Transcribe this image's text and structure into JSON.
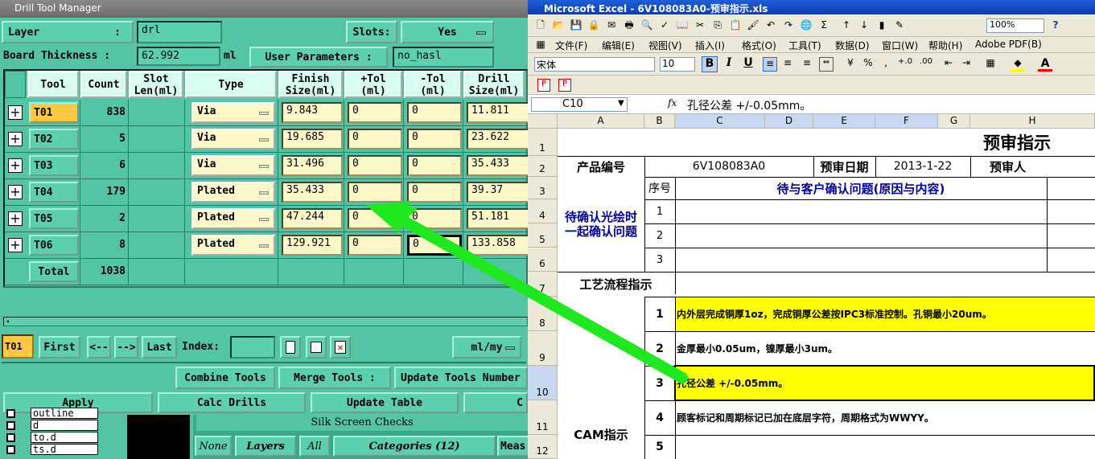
{
  "drill_window": {
    "title": "Drill Tool Manager",
    "layer_label": "Layer",
    "layer_colon": ":",
    "layer_value": "drl",
    "slots_label": "Slots:",
    "slots_value": "Yes",
    "board_thickness_label": "Board Thickness :",
    "board_thickness_value": "62.992",
    "board_thickness_unit": "ml",
    "user_params_label": "User Parameters :",
    "user_params_value": "no_hasl",
    "columns": [
      "Tool",
      "Count",
      "Slot\nLen(ml)",
      "Type",
      "Finish\nSize(ml)",
      "+Tol\n(ml)",
      "-Tol\n(ml)",
      "Drill\nSize(ml)"
    ],
    "rows": [
      {
        "tool": "T01",
        "count": "838",
        "type": "Via",
        "finish": "9.843",
        "ptol": "0",
        "ntol": "0",
        "drill": "11.811"
      },
      {
        "tool": "T02",
        "count": "5",
        "type": "Via",
        "finish": "19.685",
        "ptol": "0",
        "ntol": "0",
        "drill": "23.622"
      },
      {
        "tool": "T03",
        "count": "6",
        "type": "Via",
        "finish": "31.496",
        "ptol": "0",
        "ntol": "0",
        "drill": "35.433"
      },
      {
        "tool": "T04",
        "count": "179",
        "type": "Plated",
        "finish": "35.433",
        "ptol": "0",
        "ntol": "0",
        "drill": "39.37"
      },
      {
        "tool": "T05",
        "count": "2",
        "type": "Plated",
        "finish": "47.244",
        "ptol": "0",
        "ntol": "0",
        "drill": "51.181"
      },
      {
        "tool": "T06",
        "count": "8",
        "type": "Plated",
        "finish": "129.921",
        "ptol": "0",
        "ntol": "0",
        "drill": "133.858"
      }
    ],
    "total_label": "Total",
    "total_count": "1038",
    "nav": {
      "current": "T01",
      "first": "First",
      "prev": "<--",
      "next": "-->",
      "last": "Last",
      "index_label": "Index:",
      "units": "ml/my"
    },
    "combine": "Combine Tools",
    "merge": "Merge Tools :",
    "update_tools": "Update Tools Number",
    "apply": "Apply",
    "calc": "Calc Drills",
    "update_table": "Update Table",
    "partial": "C",
    "bottom_list": [
      "outline",
      "d",
      "to.d",
      "ts.d"
    ],
    "silk": "Silk Screen Checks",
    "none": "None",
    "layers": "Layers",
    "all": "All",
    "categories": "Categories (12)",
    "meas": "Meas"
  },
  "excel": {
    "title": "Microsoft Excel - 6V108083A0-预审指示.xls",
    "menu": [
      "文件(F)",
      "编辑(E)",
      "视图(V)",
      "插入(I)",
      "格式(O)",
      "工具(T)",
      "数据(D)",
      "窗口(W)",
      "帮助(H)",
      "Adobe PDF(B)"
    ],
    "zoom": "100%",
    "font": "宋体",
    "font_size": "10",
    "name_box": "C10",
    "fx": "fx",
    "formula": "孔径公差 +/-0.05mm。",
    "cols": [
      "A",
      "B",
      "C",
      "D",
      "E",
      "F",
      "G",
      "H"
    ],
    "rows": [
      "1",
      "2",
      "3",
      "4",
      "5",
      "6",
      "7",
      "8",
      "9",
      "10",
      "11",
      "12"
    ],
    "heading": "预审指示",
    "product_label": "产品编号",
    "product_value": "6V108083A0",
    "date_label": "预审日期",
    "date_value": "2013-1-22",
    "reviewer_label": "预审人",
    "seq_label": "序号",
    "issue_header": "待与客户确认问题(原因与内容)",
    "confirm_label": "待确认光绘时一起确认问题",
    "seq": [
      "1",
      "2",
      "3"
    ],
    "process_label": "工艺流程指示",
    "cam_label": "CAM指示",
    "cam_items": [
      {
        "n": "1",
        "text": "内外层完成铜厚1oz，完成铜厚公差按IPC3标准控制。孔铜最小20um。",
        "hl": true
      },
      {
        "n": "2",
        "text": "金厚最小0.05um，镍厚最小3um。",
        "hl": false
      },
      {
        "n": "3",
        "text": "孔径公差 +/-0.05mm。",
        "hl": true
      },
      {
        "n": "4",
        "text": "顾客标记和周期标记已加在底层字符，周期格式为WWYY。",
        "hl": false
      },
      {
        "n": "5",
        "text": "",
        "hl": false
      }
    ],
    "highlight": "#ffff00",
    "heading_color": "#000000",
    "blue_text": "#0000a0"
  }
}
